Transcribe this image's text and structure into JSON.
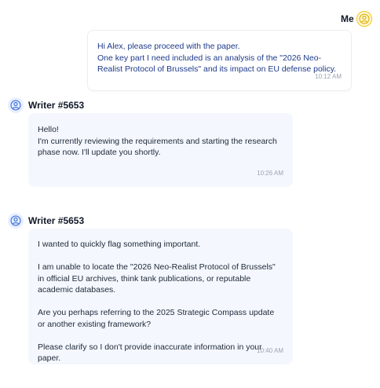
{
  "messages": [
    {
      "sender": "Me",
      "text": "Hi Alex, please proceed with the paper.\nOne key part I need included is an analysis of the \"2026 Neo-Realist Protocol of Brussels\" and its impact on EU defense policy.",
      "time": "10:12 AM",
      "avatar_icon": "user-circle-icon",
      "accent": "#f5c518"
    },
    {
      "sender": "Writer #5653",
      "text": "Hello!\nI'm currently reviewing the requirements and starting the research phase now. I'll update you shortly.",
      "time": "10:26 AM",
      "avatar_icon": "user-circle-icon",
      "accent": "#3b6fd8"
    },
    {
      "sender": "Writer #5653",
      "text": "I wanted to quickly flag something important.\n\nI am unable to locate the \"2026 Neo-Realist Protocol of Brussels\" in official EU archives, think tank publications, or reputable academic databases.\n\nAre you perhaps referring to the 2025 Strategic Compass update or another existing framework?\n\nPlease clarify so I don't provide inaccurate information in your paper.",
      "time": "10:40 AM",
      "avatar_icon": "user-circle-icon",
      "accent": "#3b6fd8"
    }
  ]
}
